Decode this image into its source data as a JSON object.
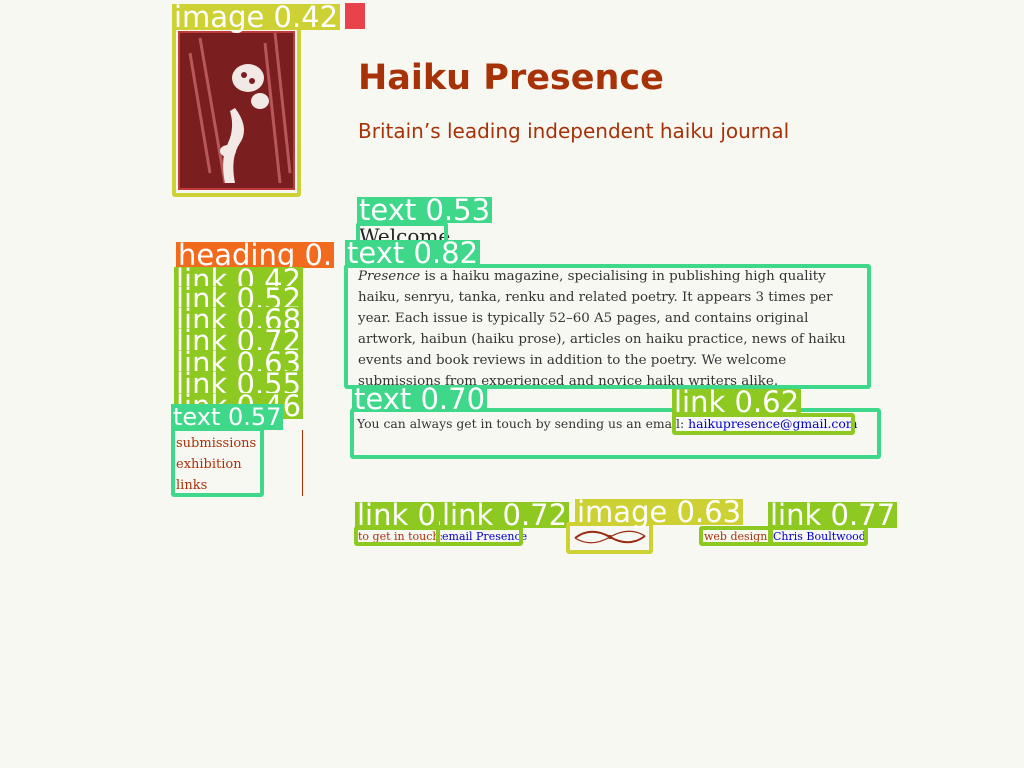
{
  "site": {
    "title": "Haiku Presence",
    "subtitle": "Britain’s leading independent haiku journal"
  },
  "main": {
    "welcome": "Welcome",
    "intro_em": "Presence",
    "intro_rest": " is a haiku magazine, specialising in publishing high quality haiku, senryu, tanka, renku and related poetry. It appears 3 times per year. Each issue is typically 52–60 A5 pages, and contains original artwork, haibun (haiku prose), articles on haiku practice, news of haiku events and book reviews in addition to the poetry. We welcome submissions from experienced and novice haiku writers alike.",
    "contact_text": "You can always get in touch by sending us an email:",
    "contact_email": "haikupresence@gmail.com"
  },
  "nav": {
    "items": [
      "submissions",
      "exhibition",
      "links"
    ]
  },
  "footer": {
    "touch_label": "to get in touch:",
    "email_link": "email Presence",
    "design_label": "web design:",
    "designer_link": "Chris Boultwood"
  },
  "overlay": {
    "image_cover": "image 0.42",
    "text_welcome": "text 0.53",
    "heading": "heading 0.",
    "text_intro": "text 0.82",
    "link_1": "link 0.42",
    "link_2": "link 0.52",
    "link_3": "link 0.68",
    "link_4": "link 0.72",
    "link_5": "link 0.63",
    "link_6": "link 0.55",
    "link_7": "link 0.46",
    "text_nav": "text 0.57",
    "text_contact": "text 0.70",
    "link_email": "link 0.62",
    "link_foot1": "link 0.",
    "link_foot2": "link 0.72",
    "image_orn": "image 0.63",
    "link_foot3": "link 0.77"
  },
  "colors": {
    "accent": "#a83208",
    "background": "#f8f8f3",
    "link": "#0000cc"
  }
}
